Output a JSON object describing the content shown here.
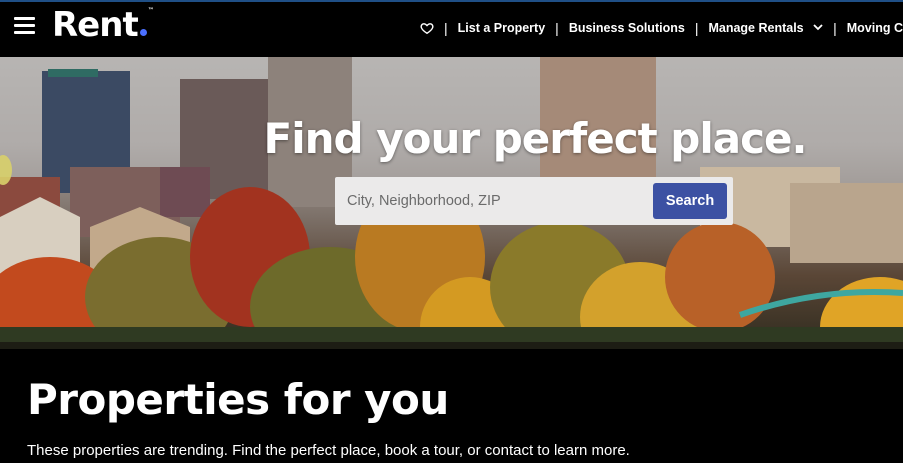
{
  "colors": {
    "header_bg": "#000000",
    "accent_dot": "#4b70ff",
    "search_button": "#3c51a3",
    "search_field_bg": "#ebeaea",
    "section_bg": "#000000"
  },
  "header": {
    "logo_text": "Rent",
    "menu_icon": "hamburger-menu-icon",
    "favorites_icon": "heart-icon",
    "nav": [
      {
        "label": "List a Property"
      },
      {
        "label": "Business Solutions"
      },
      {
        "label": "Manage Rentals",
        "has_dropdown": true
      },
      {
        "label": "Moving C"
      }
    ]
  },
  "hero": {
    "title": "Find your perfect place.",
    "search": {
      "placeholder": "City, Neighborhood, ZIP",
      "value": "",
      "button_label": "Search"
    }
  },
  "section": {
    "title": "Properties for you",
    "subtitle": "These properties are trending. Find the perfect place, book a tour, or contact to learn more."
  }
}
